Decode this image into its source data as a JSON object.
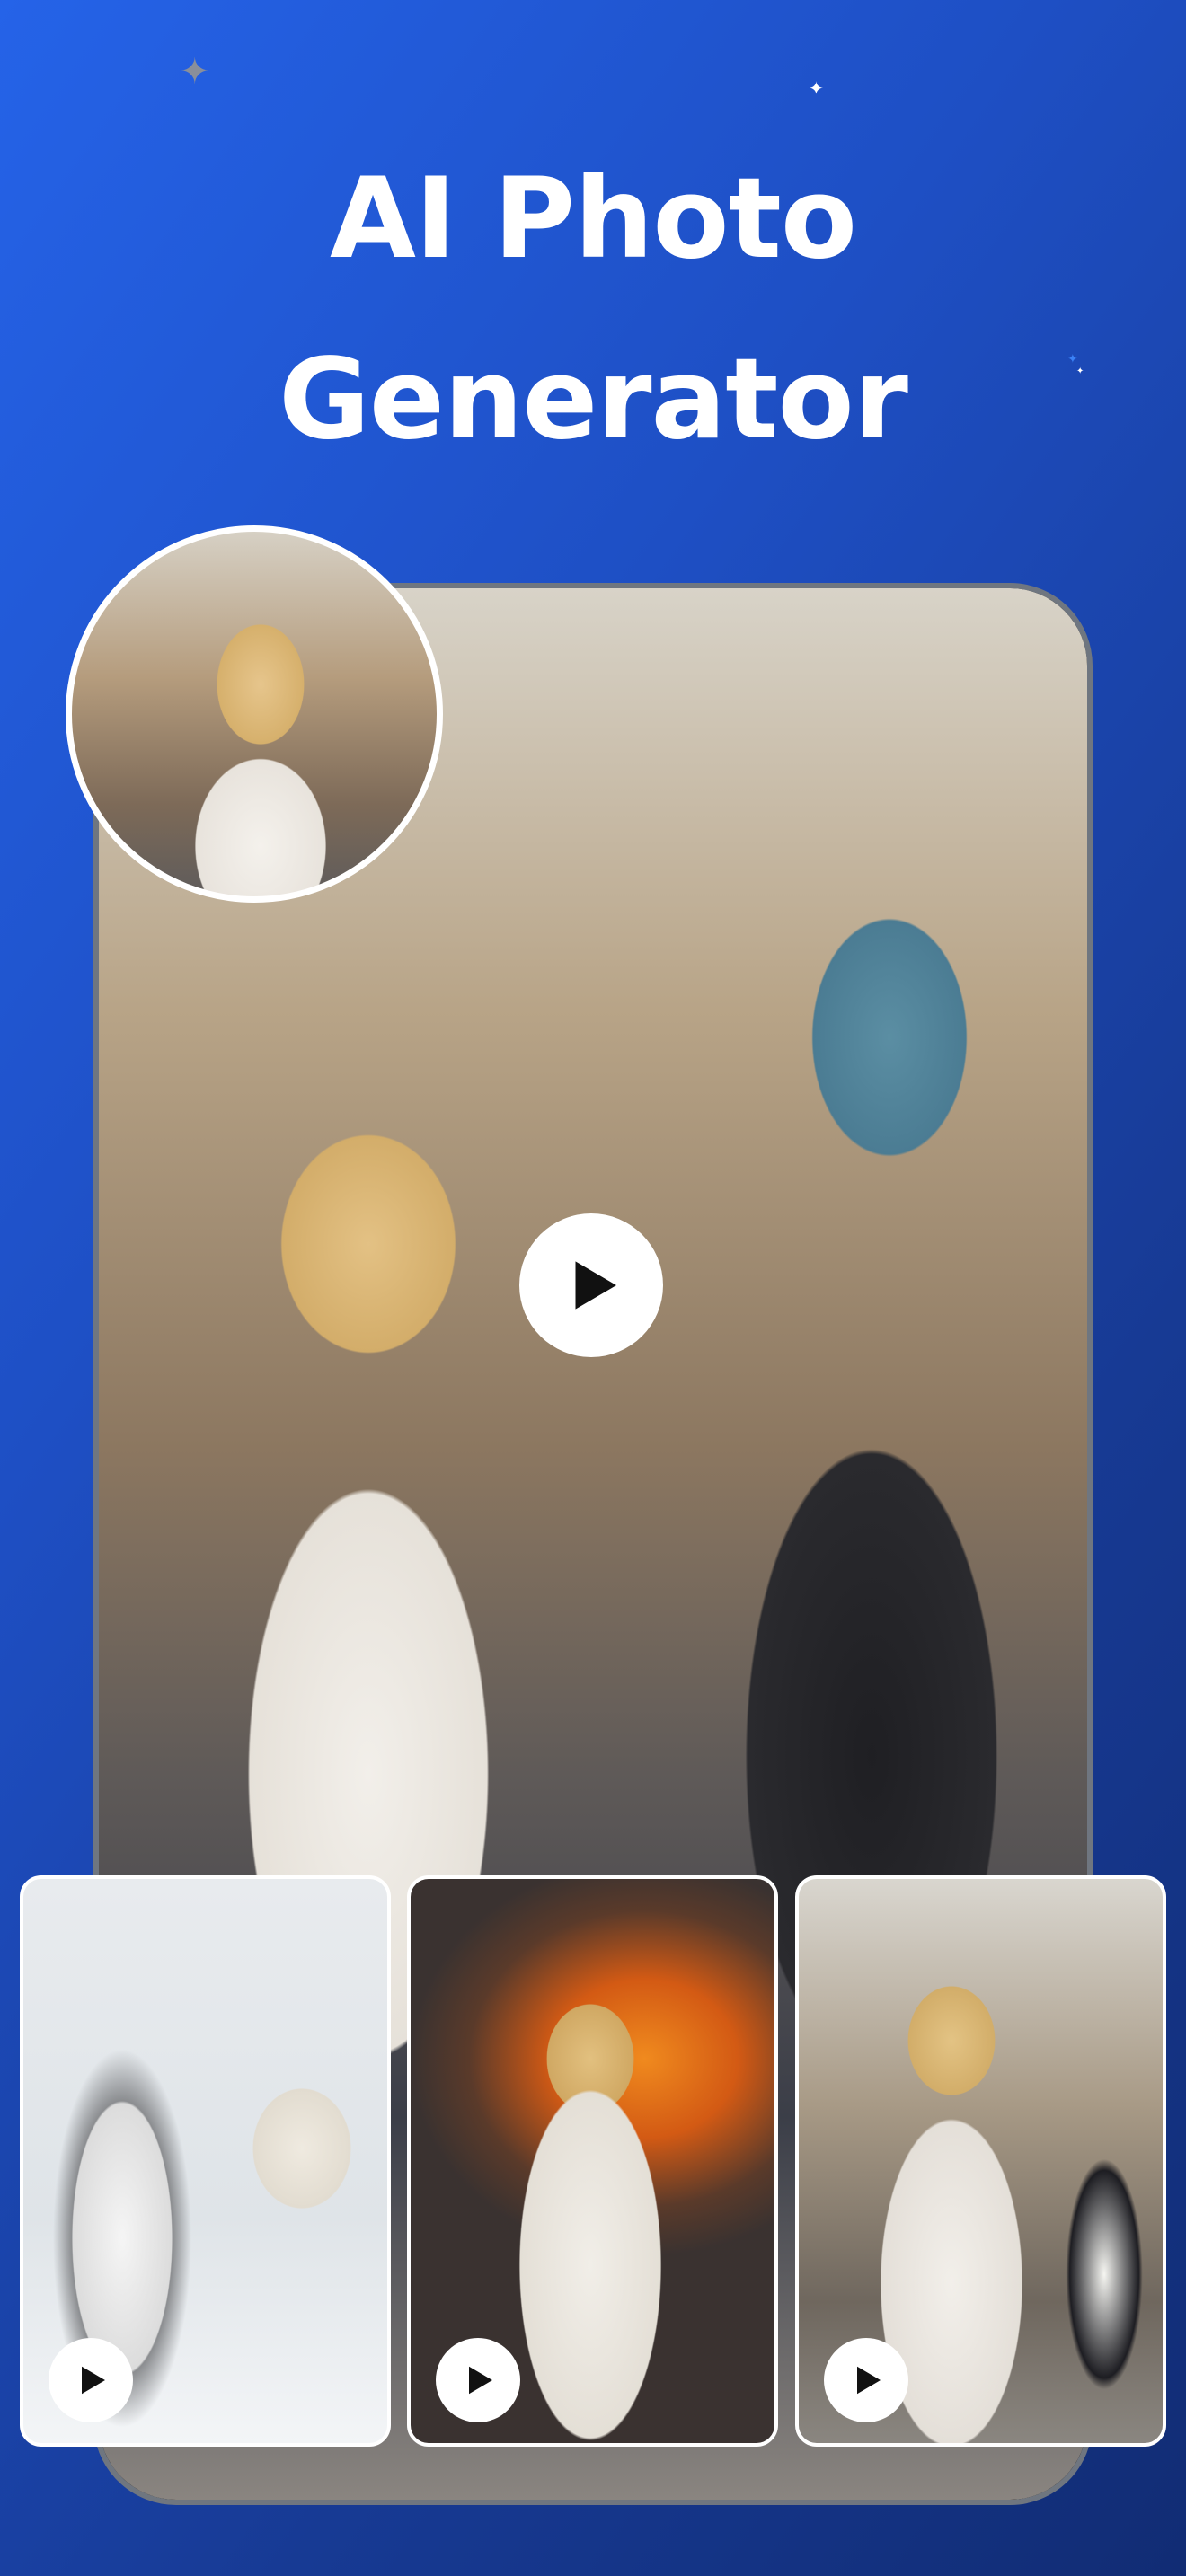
{
  "headline": {
    "line1": "AI Photo",
    "line2": "Generator"
  },
  "icons": {
    "sparkle": "sparkle-icon",
    "play": "play-icon"
  },
  "colors": {
    "background_start": "#2563e8",
    "background_end": "#112c74",
    "title": "#ffffff"
  },
  "showcase": {
    "main_video": {
      "play": "play-icon"
    },
    "source_photo": "portrait",
    "cards": [
      {
        "scene": "polar-bear-snow"
      },
      {
        "scene": "explosion"
      },
      {
        "scene": "penguin-street"
      }
    ]
  }
}
